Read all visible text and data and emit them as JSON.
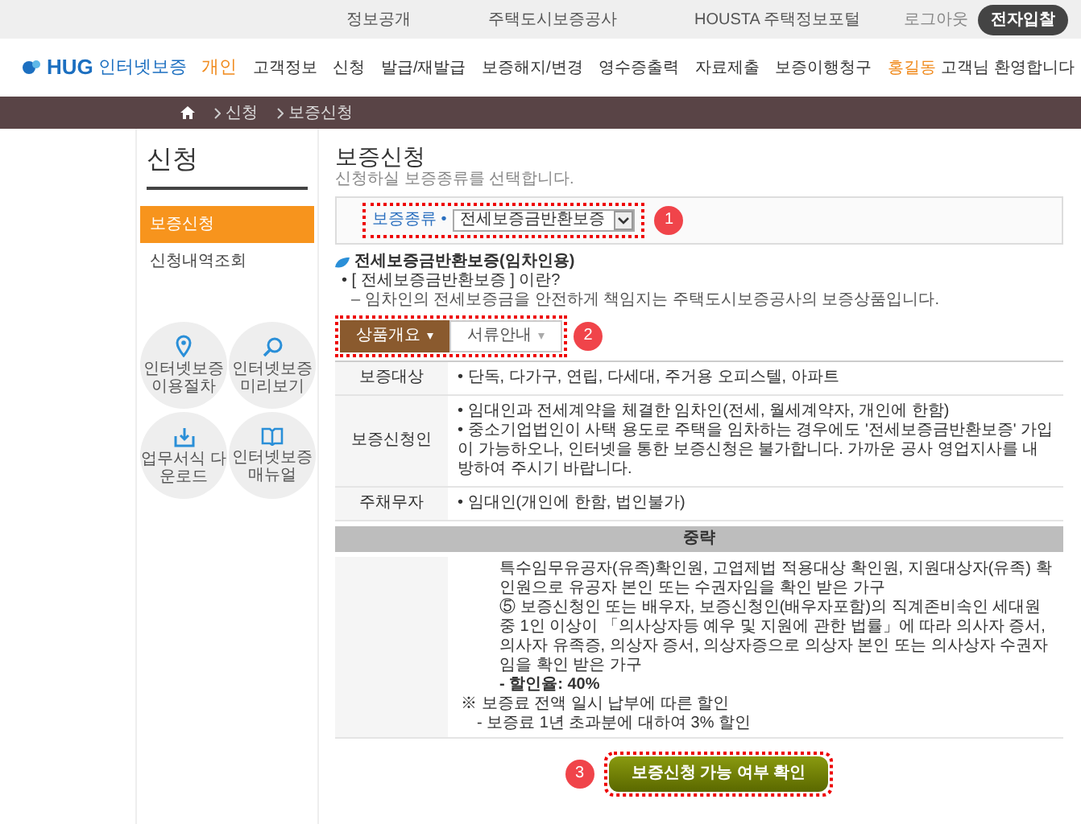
{
  "top_bar": {
    "links": [
      "정보공개",
      "주택도시보증공사",
      "HOUSTA 주택정보포털"
    ],
    "logout": "로그아웃",
    "bid_button": "전자입찰"
  },
  "header": {
    "logo_mark": "HUG",
    "logo_text": "인터넷보증",
    "section": "개인",
    "nav": [
      "고객정보",
      "신청",
      "발급/재발급",
      "보증해지/변경",
      "영수증출력",
      "자료제출",
      "보증이행청구"
    ],
    "user_name": "홍길동",
    "greeting": "고객님 환영합니다"
  },
  "breadcrumb": [
    "신청",
    "보증신청"
  ],
  "sidebar": {
    "title": "신청",
    "items": [
      {
        "label": "보증신청",
        "selected": true
      },
      {
        "label": "신청내역조회",
        "selected": false
      }
    ],
    "shortcuts": [
      {
        "label": "인터넷보증 이용절차",
        "kind": "pin"
      },
      {
        "label": "인터넷보증 미리보기",
        "kind": "search"
      },
      {
        "label": "업무서식 다운로드",
        "kind": "download"
      },
      {
        "label": "인터넷보증 매뉴얼",
        "kind": "book"
      }
    ]
  },
  "main": {
    "title": "보증신청",
    "subtitle": "신청하실 보증종류를 선택합니다.",
    "guarantee_type": {
      "label": "보증종류 •",
      "value": "전세보증금반환보증",
      "step": "1"
    },
    "product": {
      "name": "전세보증금반환보증(임차인용)",
      "question": "• [ 전세보증금반환보증 ] 이란?",
      "description": "– 임차인의 전세보증금을 안전하게 책임지는 주택도시보증공사의 보증상품입니다."
    },
    "tabs_step": "2",
    "tabs": [
      {
        "label": "상품개요",
        "selected": true
      },
      {
        "label": "서류안내",
        "selected": false
      }
    ],
    "rows": [
      {
        "header": "보증대상",
        "items": [
          "• 단독, 다가구, 연립, 다세대, 주거용 오피스텔, 아파트"
        ]
      },
      {
        "header": "보증신청인",
        "items": [
          "• 임대인과 전세계약을 체결한 임차인(전세, 월세계약자, 개인에 한함)",
          "• 중소기업법인이 사택 용도로 주택을 임차하는 경우에도 '전세보증금반환보증' 가입이 가능하오나, 인터넷을 통한 보증신청은 불가합니다. 가까운 공사 영업지사를 내방하여 주시기 바랍니다."
        ]
      },
      {
        "header": "주채무자",
        "items": [
          "• 임대인(개인에 한함, 법인불가)"
        ]
      }
    ],
    "omission": "중략",
    "continued": [
      {
        "kind": "indent",
        "text": "특수임무유공자(유족)확인원, 고엽제법 적용대상 확인원, 지원대상자(유족) 확인원으로 유공자 본인 또는 수권자임을 확인 받은 가구"
      },
      {
        "kind": "indent",
        "text": "⑤ 보증신청인 또는 배우자, 보증신청인(배우자포함)의 직계존비속인 세대원 중 1인 이상이 「의사상자등 예우 및 지원에 관한 법률」에 따라 의사자 증서, 의사자 유족증, 의상자 증서, 의상자증으로 의상자 본인 또는 의사상자 수권자임을 확인 받은 가구"
      },
      {
        "kind": "emphasis",
        "text": "- 할인율: 40%"
      },
      {
        "kind": "note",
        "text": "※ 보증료 전액 일시 납부에 따른 할인"
      },
      {
        "kind": "sub",
        "text": "- 보증료 1년 초과분에 대하여 3% 할인"
      }
    ],
    "button_step": "3",
    "button": "보증신청 가능 여부 확인"
  }
}
